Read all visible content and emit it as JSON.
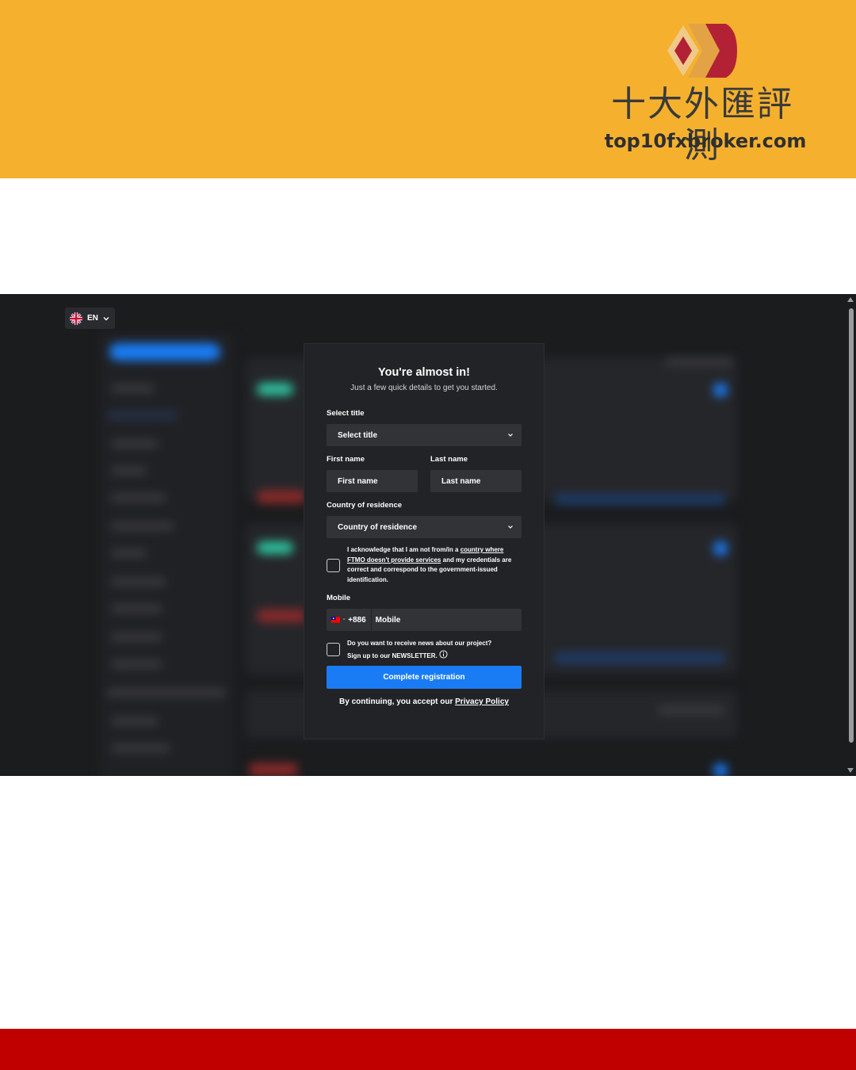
{
  "banner": {
    "brand_cn": "十大外匯評測",
    "brand_url": "top10fxbroker.com",
    "colors": {
      "background": "#F5B12E",
      "logo_red": "#B22234",
      "logo_gold": "#E3A344",
      "footer": "#C00000"
    }
  },
  "screenshot": {
    "language": {
      "code": "EN",
      "flag_icon": "uk-flag-icon"
    },
    "modal": {
      "title": "You're almost in!",
      "subtitle": "Just a few quick details to get you started.",
      "title_select": {
        "label": "Select title",
        "placeholder": "Select title"
      },
      "first_name": {
        "label": "First name",
        "placeholder": "First name"
      },
      "last_name": {
        "label": "Last name",
        "placeholder": "Last name"
      },
      "country": {
        "label": "Country of residence",
        "placeholder": "Country of residence"
      },
      "acknowledge": {
        "part1": "I acknowledge that I am not from/in a ",
        "link": "country where FTMO doesn't provide services",
        "part2": " and my credentials are correct and correspond to the government-issued identification."
      },
      "mobile": {
        "label": "Mobile",
        "code": "+886",
        "placeholder": "Mobile",
        "flag_icon": "taiwan-flag-icon"
      },
      "newsletter": {
        "line1": "Do you want to receive news about our project?",
        "line2": "Sign up to our ",
        "emphasis": "NEWSLETTER."
      },
      "submit_label": "Complete registration",
      "policy": {
        "prefix": "By continuing, you accept our ",
        "link": "Privacy Policy"
      },
      "colors": {
        "accent": "#1a7cf5",
        "surface": "#222326",
        "field": "#323337"
      }
    }
  }
}
